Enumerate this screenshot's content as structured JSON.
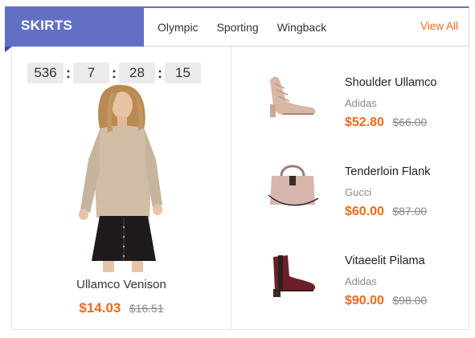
{
  "header": {
    "category": "SKIRTS",
    "tabs": [
      {
        "label": "Olympic"
      },
      {
        "label": "Sporting"
      },
      {
        "label": "Wingback"
      }
    ],
    "view_all": "View All"
  },
  "featured": {
    "countdown": [
      "536",
      "7",
      "28",
      "15"
    ],
    "separator": ":",
    "name": "Ullamco Venison",
    "price": "$14.03",
    "old_price": "$16.51"
  },
  "products": [
    {
      "name": "Shoulder Ullamco",
      "brand": "Adidas",
      "price": "$52.80",
      "old_price": "$66.00",
      "image": "heeled-sandal"
    },
    {
      "name": "Tenderloin Flank",
      "brand": "Gucci",
      "price": "$60.00",
      "old_price": "$87.00",
      "image": "handbag"
    },
    {
      "name": "Vitaeelit Pilama",
      "brand": "Adidas",
      "price": "$90.00",
      "old_price": "$98.00",
      "image": "ankle-boot"
    }
  ],
  "colors": {
    "accent": "#6270c4",
    "price": "#ee6a1a"
  }
}
